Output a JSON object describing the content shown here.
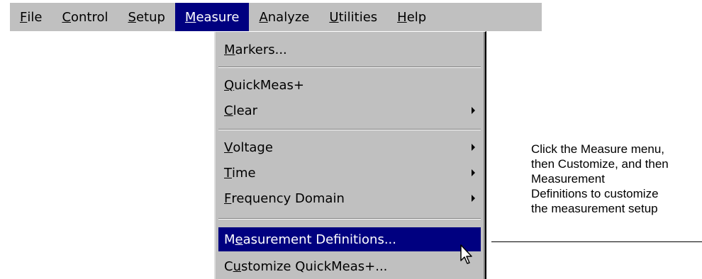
{
  "menubar": {
    "items": [
      {
        "label": "File",
        "mnemonic": "F",
        "rest": "ile"
      },
      {
        "label": "Control",
        "mnemonic": "C",
        "rest": "ontrol"
      },
      {
        "label": "Setup",
        "mnemonic": "S",
        "rest": "etup"
      },
      {
        "label": "Measure",
        "mnemonic": "M",
        "rest": "easure",
        "active": true
      },
      {
        "label": "Analyze",
        "mnemonic": "A",
        "rest": "nalyze"
      },
      {
        "label": "Utilities",
        "mnemonic": "U",
        "rest": "tilities"
      },
      {
        "label": "Help",
        "mnemonic": "H",
        "rest": "elp"
      }
    ]
  },
  "measure_menu": {
    "items": [
      {
        "label": "Markers...",
        "pre": "",
        "mn": "M",
        "post": "arkers..."
      },
      {
        "label": "QuickMeas+",
        "pre": "",
        "mn": "Q",
        "post": "uickMeas+"
      },
      {
        "label": "Clear",
        "pre": "",
        "mn": "C",
        "post": "lear",
        "submenu": true
      },
      {
        "label": "Voltage",
        "pre": "",
        "mn": "V",
        "post": "oltage",
        "submenu": true
      },
      {
        "label": "Time",
        "pre": "",
        "mn": "T",
        "post": "ime",
        "submenu": true
      },
      {
        "label": "Frequency Domain",
        "pre": "",
        "mn": "F",
        "post": "requency Domain",
        "submenu": true
      },
      {
        "label": "Measurement Definitions...",
        "pre": "M",
        "mn": "e",
        "post": "asurement Definitions...",
        "highlighted": true
      },
      {
        "label": "Customize QuickMeas+...",
        "pre": "C",
        "mn": "u",
        "post": "stomize QuickMeas+..."
      }
    ]
  },
  "annotation": {
    "line1": "Click the Measure menu,",
    "line2": "then Customize, and then",
    "line3": "Measurement",
    "line4": "Definitions to customize",
    "line5": "the measurement setup"
  },
  "colors": {
    "menu_bg": "#c0c0c0",
    "highlight": "#000080",
    "highlight_text": "#ffffff"
  },
  "icons": {
    "cursor": "arrow-pointer-icon",
    "submenu": "submenu-arrow-icon"
  }
}
